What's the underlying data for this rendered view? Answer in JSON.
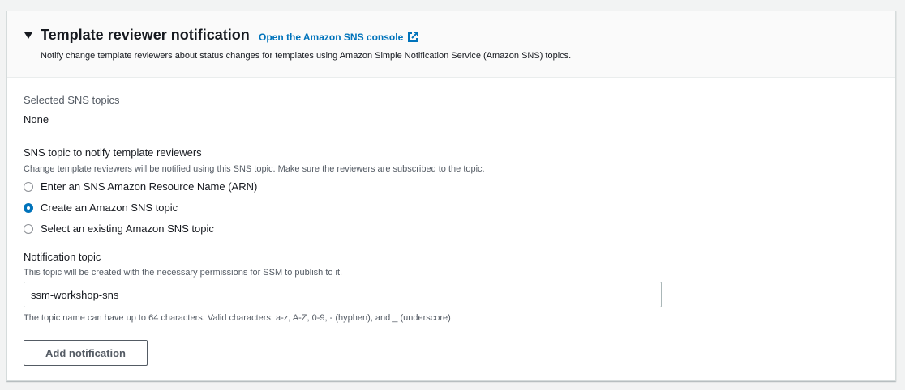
{
  "header": {
    "title": "Template reviewer notification",
    "console_link": "Open the Amazon SNS console",
    "description": "Notify change template reviewers about status changes for templates using Amazon Simple Notification Service (Amazon SNS) topics."
  },
  "selected_topics": {
    "label": "Selected SNS topics",
    "value": "None"
  },
  "topic_choice": {
    "label": "SNS topic to notify template reviewers",
    "description": "Change template reviewers will be notified using this SNS topic. Make sure the reviewers are subscribed to the topic.",
    "options": [
      {
        "label": "Enter an SNS Amazon Resource Name (ARN)",
        "checked": false
      },
      {
        "label": "Create an Amazon SNS topic",
        "checked": true
      },
      {
        "label": "Select an existing Amazon SNS topic",
        "checked": false
      }
    ]
  },
  "notification_topic": {
    "label": "Notification topic",
    "description": "This topic will be created with the necessary permissions for SSM to publish to it.",
    "value": "ssm-workshop-sns",
    "constraint": "The topic name can have up to 64 characters. Valid characters: a-z, A-Z, 0-9, - (hyphen), and _ (underscore)"
  },
  "actions": {
    "add_notification": "Add notification"
  },
  "colors": {
    "accent": "#0073bb",
    "text": "#16191f",
    "muted": "#545b64"
  },
  "icons": {
    "caret": "caret-down-icon",
    "external": "external-link-icon"
  }
}
